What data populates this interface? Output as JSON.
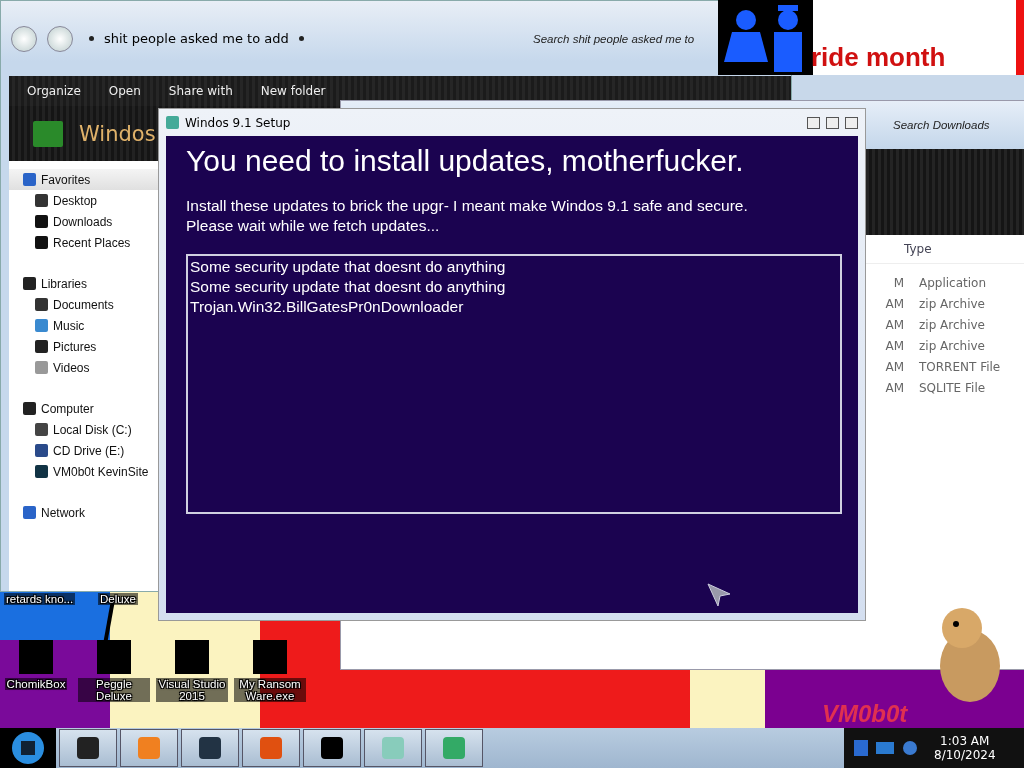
{
  "explorer": {
    "address": "shit people asked me to add",
    "search_placeholder": "Search shit people asked me to",
    "toolbar": [
      "Organize",
      "Open",
      "Share with",
      "New folder"
    ],
    "heading": "Windos",
    "sidebar": [
      {
        "label": "Favorites",
        "selected": true,
        "children": [
          {
            "label": "Desktop",
            "selected": false
          },
          {
            "label": "Downloads",
            "selected": false
          },
          {
            "label": "Recent Places",
            "selected": false
          }
        ]
      },
      {
        "label": "Libraries",
        "selected": false,
        "children": [
          {
            "label": "Documents",
            "selected": false
          },
          {
            "label": "Music",
            "selected": false
          },
          {
            "label": "Pictures",
            "selected": false
          },
          {
            "label": "Videos",
            "selected": false
          }
        ]
      },
      {
        "label": "Computer",
        "selected": false,
        "children": [
          {
            "label": "Local Disk (C:)",
            "selected": false
          },
          {
            "label": "CD Drive (E:)",
            "selected": false
          },
          {
            "label": "VM0b0t KevinSite",
            "selected": false
          }
        ]
      },
      {
        "label": "Network",
        "selected": false
      }
    ]
  },
  "downloads": {
    "search_placeholder": "Search Downloads",
    "columns": [
      "Type"
    ],
    "rows": [
      {
        "column_1": "M",
        "type": "Application"
      },
      {
        "column_1": "AM",
        "type": "zip Archive"
      },
      {
        "column_1": "AM",
        "type": "zip Archive"
      },
      {
        "column_1": "AM",
        "type": "zip Archive"
      },
      {
        "column_1": "AM",
        "type": "TORRENT File"
      },
      {
        "column_1": "AM",
        "type": "SQLITE File"
      }
    ]
  },
  "banner": {
    "text": "ride month"
  },
  "setup": {
    "title": "Windos 9.1 Setup",
    "heading": "You need to install updates, motherfucker.",
    "description": [
      "Install these updates to brick the upgr- I meant make Windos 9.1 safe and secure.",
      "Please wait while we fetch updates..."
    ],
    "updates": [
      "Some security update that doesnt do anything",
      "Some security update that doesnt do anything",
      "Trojan.Win32.BillGatesPr0nDownloader"
    ]
  },
  "desktop": {
    "cut_labels": [
      "retards kno...",
      "Deluxe"
    ],
    "icons": [
      {
        "label": "ChomikBox"
      },
      {
        "label": "Peggle Deluxe"
      },
      {
        "label": "Visual Studio 2015"
      },
      {
        "label": "My Ransom Ware.exe"
      }
    ],
    "wallpaper_text": "VM0b0t"
  },
  "taskbar": {
    "time": "1:03 AM",
    "date": "8/10/2024"
  }
}
